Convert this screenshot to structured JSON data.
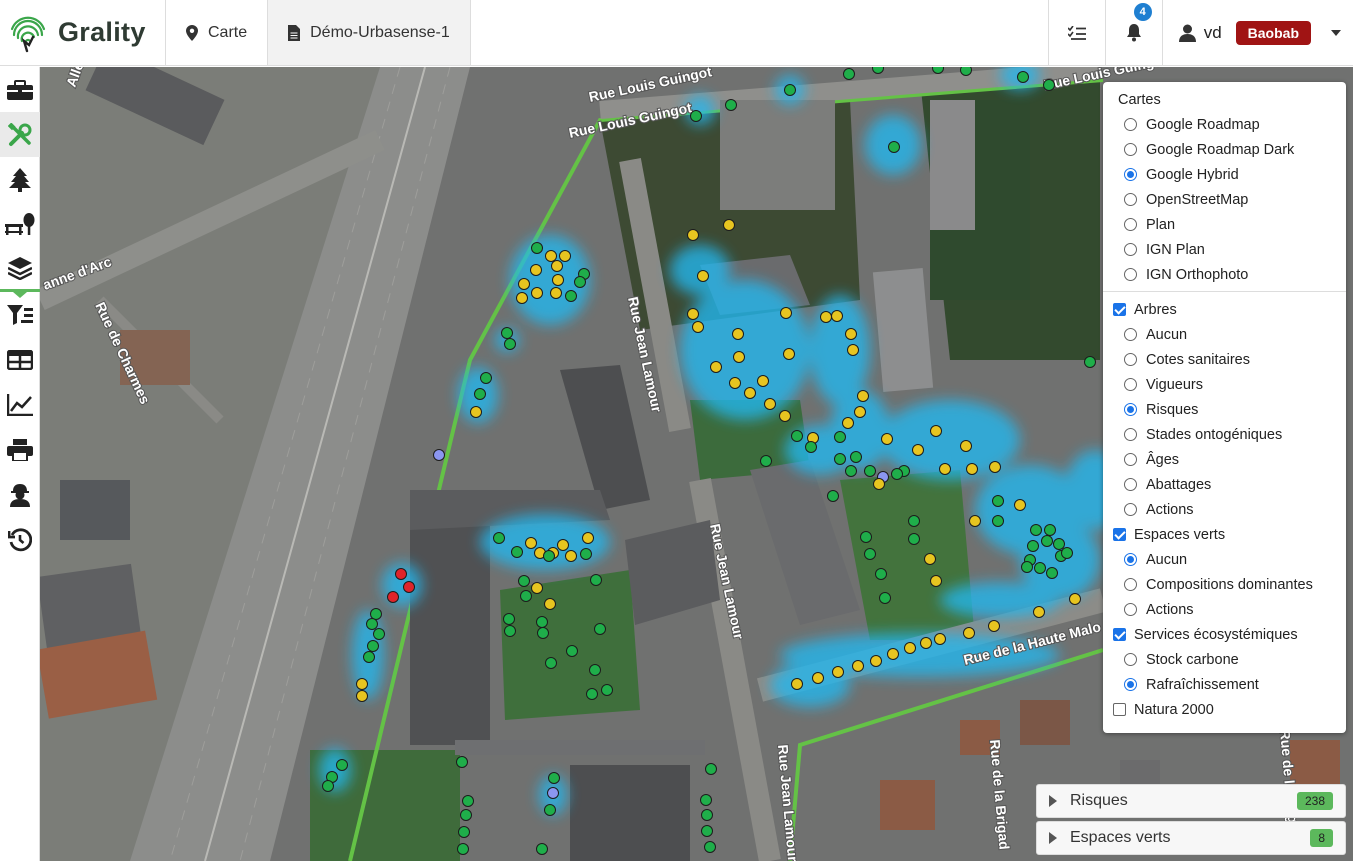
{
  "app": {
    "name": "Grality"
  },
  "header": {
    "tabs": [
      {
        "label": "Carte",
        "icon": "map-marker-icon"
      },
      {
        "label": "Démo-Urbasense-1",
        "icon": "document-icon"
      }
    ],
    "notifications_count": "4",
    "user": {
      "name": "vd",
      "role": "Baobab"
    }
  },
  "sidebar": {
    "items": [
      {
        "name": "toolbox-icon"
      },
      {
        "name": "tools-icon"
      },
      {
        "name": "tree-icon"
      },
      {
        "name": "bench-tree-icon"
      },
      {
        "name": "layers-icon"
      },
      {
        "name": "filter-icon"
      },
      {
        "name": "table-icon"
      },
      {
        "name": "chart-line-icon"
      },
      {
        "name": "printer-icon"
      },
      {
        "name": "worker-icon"
      },
      {
        "name": "history-icon"
      }
    ]
  },
  "map": {
    "street_labels": [
      "Rue Louis Guingot",
      "Rue Louis Guingot",
      "Rue Jean Lamour",
      "Rue Jean Lamour",
      "Rue Jean Lamour",
      "Rue de la Haute Malo",
      "Rue de Charmes",
      "anne d'Arc",
      "Rue de la Brigad",
      "Rue de la Brigad",
      "Alle",
      "Rue Louis Guingot"
    ]
  },
  "layers": {
    "basemaps_title": "Cartes",
    "basemaps": [
      {
        "label": "Google Roadmap",
        "selected": false
      },
      {
        "label": "Google Roadmap Dark",
        "selected": false
      },
      {
        "label": "Google Hybrid",
        "selected": true
      },
      {
        "label": "OpenStreetMap",
        "selected": false
      },
      {
        "label": "Plan",
        "selected": false
      },
      {
        "label": "IGN Plan",
        "selected": false
      },
      {
        "label": "IGN Orthophoto",
        "selected": false
      }
    ],
    "overlays": [
      {
        "label": "Arbres",
        "checked": true,
        "options": [
          {
            "label": "Aucun",
            "selected": false
          },
          {
            "label": "Cotes sanitaires",
            "selected": false
          },
          {
            "label": "Vigueurs",
            "selected": false
          },
          {
            "label": "Risques",
            "selected": true
          },
          {
            "label": "Stades ontogéniques",
            "selected": false
          },
          {
            "label": "Âges",
            "selected": false
          },
          {
            "label": "Abattages",
            "selected": false
          },
          {
            "label": "Actions",
            "selected": false
          }
        ]
      },
      {
        "label": "Espaces verts",
        "checked": true,
        "options": [
          {
            "label": "Aucun",
            "selected": true
          },
          {
            "label": "Compositions dominantes",
            "selected": false
          },
          {
            "label": "Actions",
            "selected": false
          }
        ]
      },
      {
        "label": "Services écosystémiques",
        "checked": true,
        "options": [
          {
            "label": "Stock carbone",
            "selected": false
          },
          {
            "label": "Rafraîchissement",
            "selected": true
          }
        ]
      },
      {
        "label": "Natura 2000",
        "checked": false,
        "options": []
      }
    ]
  },
  "bottom_panels": [
    {
      "label": "Risques",
      "count": "238"
    },
    {
      "label": "Espaces verts",
      "count": "8"
    }
  ],
  "colors": {
    "accent_green": "#5cb85c",
    "risk_low": "#1fae4a",
    "risk_medium": "#e7c520",
    "risk_high": "#e0242a",
    "risk_unknown": "#8b96f0",
    "cooling_halo": "#22b8f0",
    "role_badge": "#a01414"
  }
}
